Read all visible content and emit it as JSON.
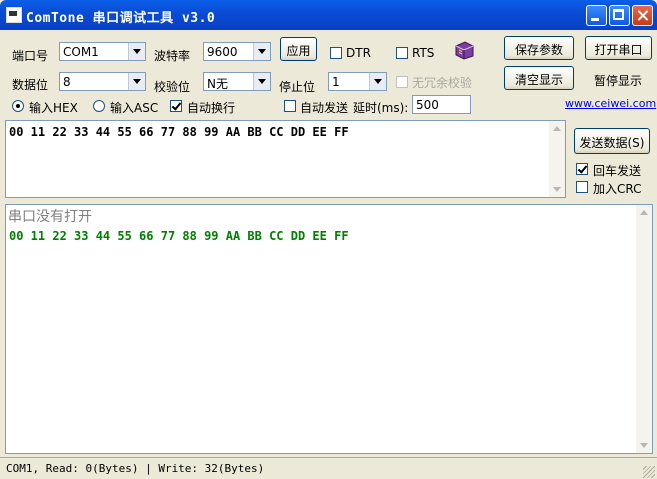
{
  "window": {
    "title": "ComTone 串口调试工具 v3.0"
  },
  "settings": {
    "port_label": "端口号",
    "port_value": "COM1",
    "baud_label": "波特率",
    "baud_value": "9600",
    "apply_label": "应用",
    "dtr_label": "DTR",
    "rts_label": "RTS",
    "databits_label": "数据位",
    "databits_value": "8",
    "parity_label": "校验位",
    "parity_value": "N无",
    "stopbits_label": "停止位",
    "stopbits_value": "1",
    "noredundant_label": "无冗余校验"
  },
  "buttons": {
    "save_params": "保存参数",
    "open_port": "打开串口",
    "clear_display": "清空显示",
    "pause_display": "暂停显示",
    "send_data": "发送数据(S)"
  },
  "input": {
    "hex_label": "输入HEX",
    "asc_label": "输入ASC",
    "autowrap_label": "自动换行",
    "autosend_label": "自动发送",
    "delay_label": "延时(ms):",
    "delay_value": "500"
  },
  "website": "www.ceiwei.com",
  "send_text": "00 11 22 33 44 55 66 77 88 99 AA BB CC DD EE FF",
  "send_options": {
    "enter_send": "回车发送",
    "add_crc": "加入CRC"
  },
  "receive": {
    "status_line": "串口没有打开",
    "data_line": "00 11 22 33 44 55 66 77 88 99 AA BB CC DD EE FF"
  },
  "statusbar": "COM1, Read: 0(Bytes) | Write: 32(Bytes)",
  "colors": {
    "title_bar": "#0a4cd6",
    "received_text": "#008000",
    "status_gray": "#808080",
    "link": "#0000ee"
  }
}
